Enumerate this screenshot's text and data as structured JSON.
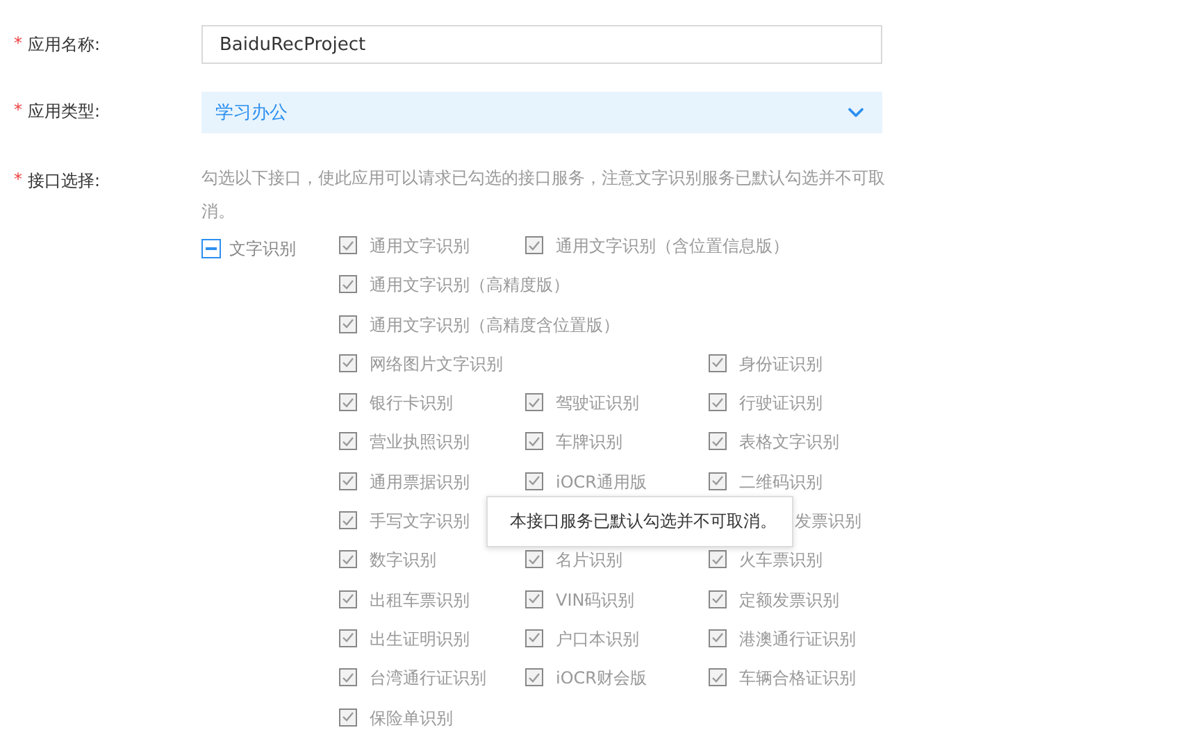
{
  "fields": [
    {
      "marker": "*",
      "label": "应用名称:",
      "kind": "text",
      "value": "BaiduRecProject"
    },
    {
      "marker": "*",
      "label": "应用类型:",
      "kind": "select",
      "value": "学习办公"
    }
  ],
  "interfaces": {
    "marker": "*",
    "label": "接口选择:",
    "description": "勾选以下接口，使此应用可以请求已勾选的接口服务，注意文字识别服务已默认勾选并不可取消。",
    "group": {
      "label": "文字识别",
      "indeterminate": true
    },
    "rows": [
      [
        {
          "label": "通用文字识别",
          "checked": true
        },
        {
          "label": "通用文字识别（含位置信息版）",
          "checked": true
        }
      ],
      [
        {
          "label": "通用文字识别（高精度版）",
          "checked": true
        }
      ],
      [
        {
          "label": "通用文字识别（高精度含位置版）",
          "checked": true
        }
      ],
      [
        {
          "label": "网络图片文字识别",
          "checked": true
        },
        null,
        {
          "label": "身份证识别",
          "checked": true
        }
      ],
      [
        {
          "label": "银行卡识别",
          "checked": true
        },
        {
          "label": "驾驶证识别",
          "checked": true
        },
        {
          "label": "行驶证识别",
          "checked": true
        }
      ],
      [
        {
          "label": "营业执照识别",
          "checked": true
        },
        {
          "label": "车牌识别",
          "checked": true
        },
        {
          "label": "表格文字识别",
          "checked": true
        }
      ],
      [
        {
          "label": "通用票据识别",
          "checked": true
        },
        {
          "label": "iOCR通用版",
          "checked": true
        },
        {
          "label": "二维码识别",
          "checked": true
        }
      ],
      [
        {
          "label": "手写文字识别",
          "checked": true
        },
        null,
        {
          "label": "发票识别",
          "kind": "covered"
        }
      ],
      [
        {
          "label": "数字识别",
          "checked": true
        },
        {
          "label": "名片识别",
          "checked": true
        },
        {
          "label": "火车票识别",
          "checked": true
        }
      ],
      [
        {
          "label": "出租车票识别",
          "checked": true
        },
        {
          "label": "VIN码识别",
          "checked": true
        },
        {
          "label": "定额发票识别",
          "checked": true
        }
      ],
      [
        {
          "label": "出生证明识别",
          "checked": true
        },
        {
          "label": "户口本识别",
          "checked": true
        },
        {
          "label": "港澳通行证识别",
          "checked": true
        }
      ],
      [
        {
          "label": "台湾通行证识别",
          "checked": true
        },
        {
          "label": "iOCR财会版",
          "checked": true
        },
        {
          "label": "车辆合格证识别",
          "checked": true
        }
      ],
      [
        {
          "label": "保险单识别",
          "checked": true
        }
      ]
    ]
  },
  "tooltip": {
    "text": "本接口服务已默认勾选并不可取消。"
  }
}
